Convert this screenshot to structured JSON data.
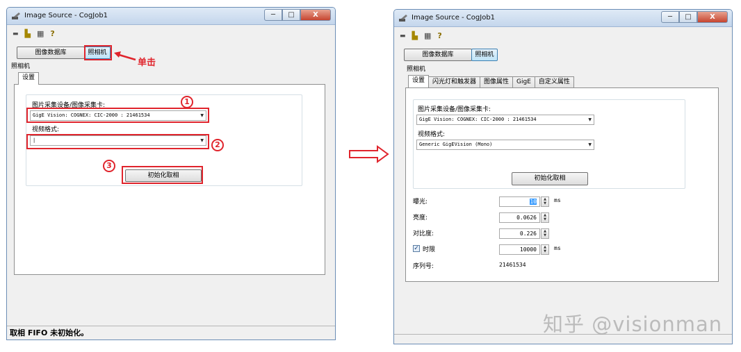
{
  "window_left": {
    "title": "Image Source - CogJob1",
    "buttons": {
      "image_db": "图像数据库",
      "camera": "照相机"
    },
    "click_hint": "单击",
    "section_label": "照相机",
    "tabs": [
      "设置"
    ],
    "device_label": "图片采集设备/图像采集卡:",
    "device_value": "GigE Vision: COGNEX: CIC-2000 : 21461534",
    "video_format_label": "视频格式:",
    "video_format_value": "|",
    "init_button": "初始化取相",
    "markers": [
      "1",
      "2",
      "3"
    ],
    "status": "取相 FIFO 未初始化。"
  },
  "window_right": {
    "title": "Image Source - CogJob1",
    "buttons": {
      "image_db": "图像数据库",
      "camera": "照相机"
    },
    "section_label": "照相机",
    "tabs": [
      "设置",
      "闪光灯和触发器",
      "图像属性",
      "GigE",
      "自定义属性"
    ],
    "device_label": "图片采集设备/图像采集卡:",
    "device_value": "GigE Vision: COGNEX: CIC-2000 : 21461534",
    "video_format_label": "视频格式:",
    "video_format_value": "Generic GigEVision (Mono)",
    "init_button": "初始化取相",
    "props": {
      "exposure_label": "曝光:",
      "exposure_value": "10",
      "exposure_unit": "ms",
      "brightness_label": "亮度:",
      "brightness_value": "0.0626",
      "contrast_label": "对比度:",
      "contrast_value": "0.226",
      "timeout_label": "时限",
      "timeout_value": "10000",
      "timeout_unit": "ms",
      "timeout_checked": true,
      "serial_label": "序列号:",
      "serial_value": "21461534"
    }
  },
  "window_controls": {
    "minimize": "─",
    "maximize": "□",
    "close": "X"
  },
  "watermark": "知乎 @visionman",
  "colors": {
    "annotation": "#e0242c",
    "titlebar": "#c4d6ec"
  }
}
